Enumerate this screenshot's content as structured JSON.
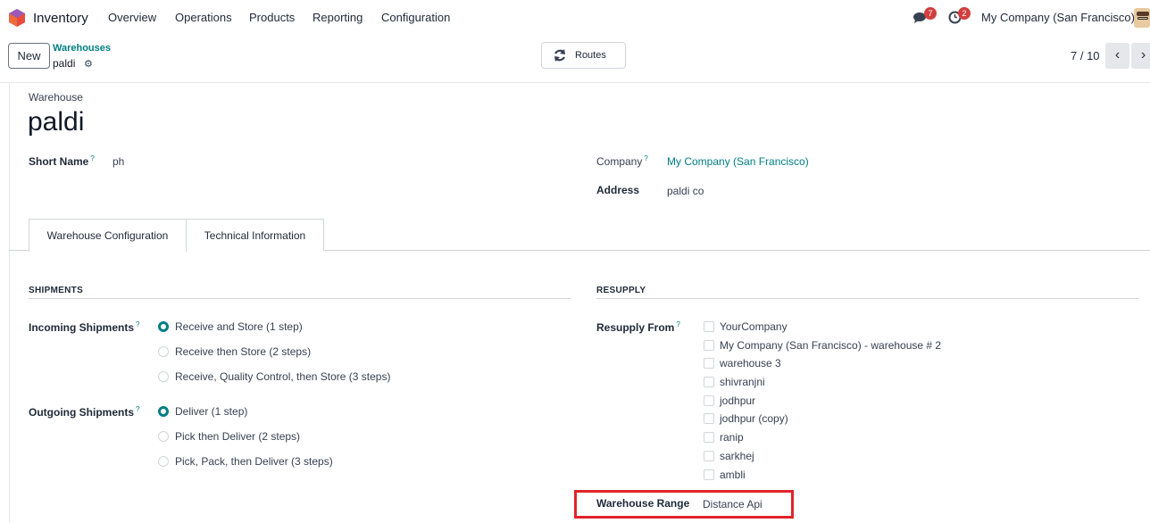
{
  "navbar": {
    "app_name": "Inventory",
    "menu": [
      "Overview",
      "Operations",
      "Products",
      "Reporting",
      "Configuration"
    ],
    "messages_count": "7",
    "activities_count": "2",
    "company": "My Company (San Francisco)"
  },
  "control": {
    "new_label": "New",
    "breadcrumb_parent": "Warehouses",
    "breadcrumb_current": "paldi",
    "routes_label": "Routes",
    "pager": "7 / 10"
  },
  "form": {
    "record_type": "Warehouse",
    "name": "paldi",
    "short_name_label": "Short Name",
    "short_name": "ph",
    "company_label": "Company",
    "company": "My Company (San Francisco)",
    "address_label": "Address",
    "address": "paldi co"
  },
  "tabs": [
    "Warehouse Configuration",
    "Technical Information"
  ],
  "shipments": {
    "title": "SHIPMENTS",
    "incoming_label": "Incoming Shipments",
    "incoming_options": [
      {
        "label": "Receive and Store (1 step)",
        "checked": true
      },
      {
        "label": "Receive then Store (2 steps)",
        "checked": false
      },
      {
        "label": "Receive, Quality Control, then Store (3 steps)",
        "checked": false
      }
    ],
    "outgoing_label": "Outgoing Shipments",
    "outgoing_options": [
      {
        "label": "Deliver (1 step)",
        "checked": true
      },
      {
        "label": "Pick then Deliver (2 steps)",
        "checked": false
      },
      {
        "label": "Pick, Pack, then Deliver (3 steps)",
        "checked": false
      }
    ]
  },
  "resupply": {
    "title": "RESUPPLY",
    "from_label": "Resupply From",
    "warehouses": [
      "YourCompany",
      "My Company (San Francisco) - warehouse # 2",
      "warehouse 3",
      "shivranjni",
      "jodhpur",
      "jodhpur (copy)",
      "ranip",
      "sarkhej",
      "ambli"
    ],
    "range_label": "Warehouse Range",
    "range_value": "Distance Api"
  },
  "colors": {
    "accent": "#017e84",
    "badge": "#d23f3f",
    "highlight": "#e0242b"
  }
}
